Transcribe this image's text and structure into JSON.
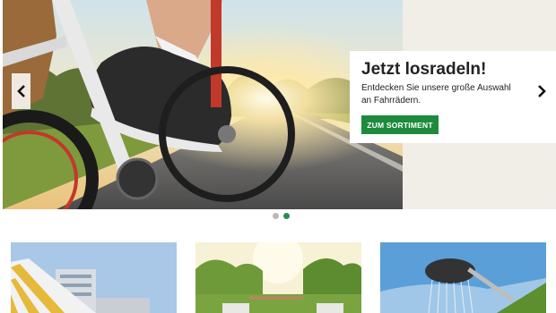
{
  "hero": {
    "title": "Jetzt losradeln!",
    "description": "Entdecken Sie unsere große Auswahl an Fahrrädern.",
    "button_label": "ZUM SORTIMENT",
    "prev_icon": "chevron-left-icon",
    "next_icon": "chevron-right-icon",
    "slides_total": 2,
    "active_slide": 2
  },
  "colors": {
    "accent": "#1e8a3e",
    "dot_active": "#2e8b57",
    "dot_inactive": "#b9b9b9",
    "panel_background": "#f0eee6"
  },
  "teasers": [
    {
      "image": "awning-image"
    },
    {
      "image": "garden-image"
    },
    {
      "image": "shower-image"
    }
  ]
}
